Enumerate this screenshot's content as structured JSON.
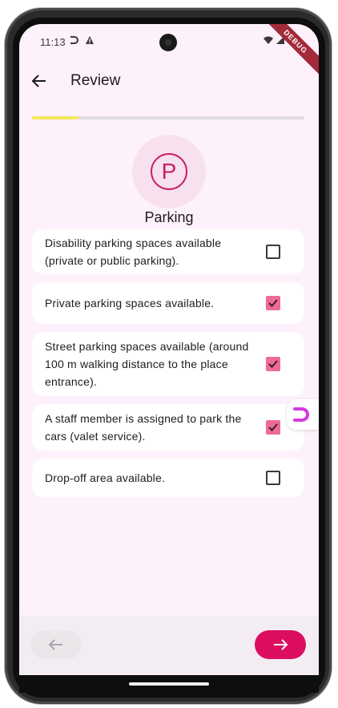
{
  "status_bar": {
    "time": "11:13",
    "debug_badge": "DEBUG"
  },
  "app_bar": {
    "title": "Review"
  },
  "progress": {
    "fraction": 0.17,
    "color": "#f2e85c"
  },
  "section": {
    "icon": "parking-icon",
    "icon_glyph": "P",
    "title": "Parking"
  },
  "items": [
    {
      "label": "Disability parking spaces available (private or public parking).",
      "checked": false
    },
    {
      "label": "Private parking spaces available.",
      "checked": true
    },
    {
      "label": "Street parking spaces available (around 100 m walking distance to the place entrance).",
      "checked": true
    },
    {
      "label": "A staff member is assigned to park the cars (valet service).",
      "checked": true
    },
    {
      "label": "Drop-off area available.",
      "checked": false
    }
  ],
  "colors": {
    "accent": "#dd0d62",
    "checkbox_checked": "#ee6a9a",
    "background": "#fdf2fb"
  }
}
